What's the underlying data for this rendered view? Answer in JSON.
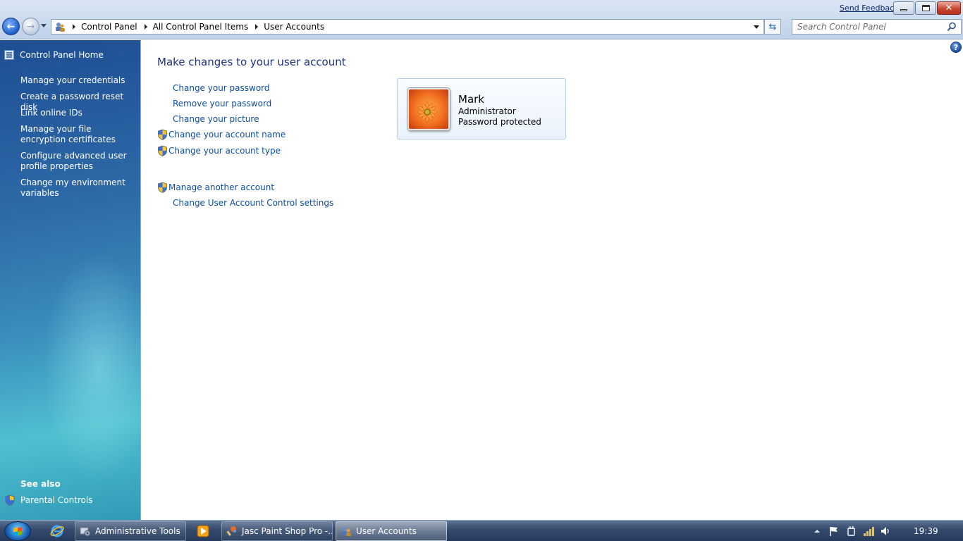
{
  "window": {
    "send_feedback": "Send Feedback",
    "breadcrumb": [
      "Control Panel",
      "All Control Panel Items",
      "User Accounts"
    ],
    "search_placeholder": "Search Control Panel"
  },
  "sidebar": {
    "home": "Control Panel Home",
    "links": [
      "Manage your credentials",
      "Create a password reset disk",
      "Link online IDs",
      "Manage your file encryption certificates",
      "Configure advanced user profile properties",
      "Change my environment variables"
    ],
    "see_also": "See also",
    "parental_controls": "Parental Controls"
  },
  "main": {
    "title": "Make changes to your user account",
    "tasks": [
      {
        "label": "Change your password",
        "shield": false
      },
      {
        "label": "Remove your password",
        "shield": false
      },
      {
        "label": "Change your picture",
        "shield": false
      },
      {
        "label": "Change your account name",
        "shield": true
      },
      {
        "label": "Change your account type",
        "shield": true
      },
      {
        "label": "Manage another account",
        "shield": true
      },
      {
        "label": "Change User Account Control settings",
        "shield": false
      }
    ],
    "account": {
      "name": "Mark",
      "role": "Administrator",
      "status": "Password protected"
    }
  },
  "taskbar": {
    "items": [
      {
        "label": "Administrative Tools",
        "active": false
      },
      {
        "label": "Jasc Paint Shop Pro -...",
        "active": false
      },
      {
        "label": "User Accounts",
        "active": true
      }
    ],
    "clock": "19:39"
  },
  "colors": {
    "link": "#0b4ea2",
    "title": "#1e3287",
    "sidebar_top": "#1f4e93",
    "sidebar_bottom": "#4fc0d0"
  }
}
